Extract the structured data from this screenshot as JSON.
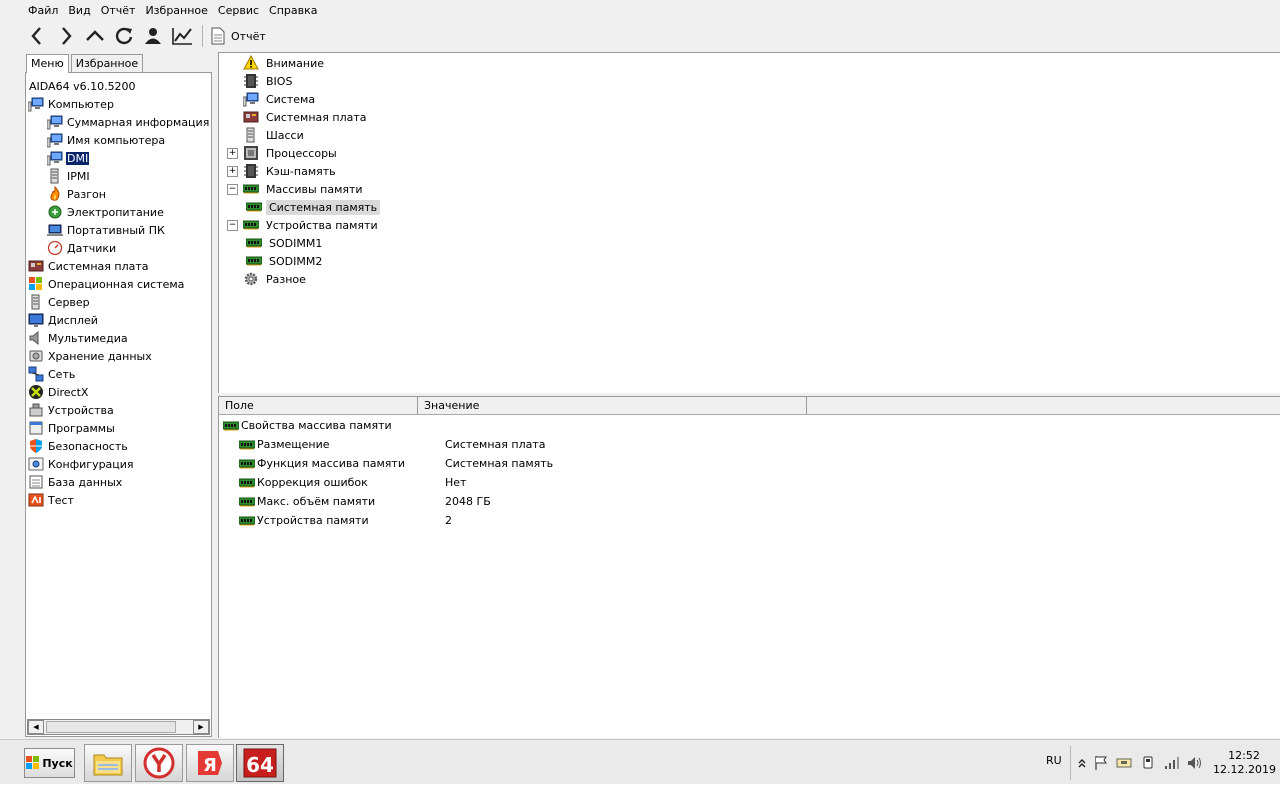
{
  "menubar": {
    "items": [
      "Файл",
      "Вид",
      "Отчёт",
      "Избранное",
      "Сервис",
      "Справка"
    ]
  },
  "toolbar": {
    "report_label": "Отчёт",
    "buttons": [
      "back-icon",
      "forward-icon",
      "up-icon",
      "refresh-icon",
      "user-icon",
      "chart-icon"
    ]
  },
  "left_tabs": [
    "Меню",
    "Избранное"
  ],
  "left_tree": [
    {
      "label": "AIDA64 v6.10.5200",
      "level": 0,
      "icon": "none"
    },
    {
      "label": "Компьютер",
      "level": 0,
      "icon": "computer-icon"
    },
    {
      "label": "Суммарная информация",
      "level": 1,
      "icon": "computer-icon"
    },
    {
      "label": "Имя компьютера",
      "level": 1,
      "icon": "computer-icon"
    },
    {
      "label": "DMI",
      "level": 1,
      "icon": "computer-icon",
      "selected": true
    },
    {
      "label": "IPMI",
      "level": 1,
      "icon": "server-icon"
    },
    {
      "label": "Разгон",
      "level": 1,
      "icon": "flame-icon"
    },
    {
      "label": "Электропитание",
      "level": 1,
      "icon": "power-icon"
    },
    {
      "label": "Портативный ПК",
      "level": 1,
      "icon": "laptop-icon"
    },
    {
      "label": "Датчики",
      "level": 1,
      "icon": "gauge-icon"
    },
    {
      "label": "Системная плата",
      "level": 0,
      "icon": "motherboard-icon"
    },
    {
      "label": "Операционная система",
      "level": 0,
      "icon": "windows-icon"
    },
    {
      "label": "Сервер",
      "level": 0,
      "icon": "server-icon"
    },
    {
      "label": "Дисплей",
      "level": 0,
      "icon": "monitor-icon"
    },
    {
      "label": "Мультимедиа",
      "level": 0,
      "icon": "speaker-icon"
    },
    {
      "label": "Хранение данных",
      "level": 0,
      "icon": "storage-icon"
    },
    {
      "label": "Сеть",
      "level": 0,
      "icon": "network-icon"
    },
    {
      "label": "DirectX",
      "level": 0,
      "icon": "directx-icon"
    },
    {
      "label": "Устройства",
      "level": 0,
      "icon": "devices-icon"
    },
    {
      "label": "Программы",
      "level": 0,
      "icon": "programs-icon"
    },
    {
      "label": "Безопасность",
      "level": 0,
      "icon": "shield-icon"
    },
    {
      "label": "Конфигурация",
      "level": 0,
      "icon": "config-icon"
    },
    {
      "label": "База данных",
      "level": 0,
      "icon": "database-icon"
    },
    {
      "label": "Тест",
      "level": 0,
      "icon": "benchmark-icon"
    }
  ],
  "right_tree": [
    {
      "label": "Внимание",
      "level": 0,
      "icon": "warning-icon",
      "expander": "none"
    },
    {
      "label": "BIOS",
      "level": 0,
      "icon": "chip-icon",
      "expander": "none"
    },
    {
      "label": "Система",
      "level": 0,
      "icon": "computer-icon",
      "expander": "none"
    },
    {
      "label": "Системная плата",
      "level": 0,
      "icon": "motherboard-icon",
      "expander": "none"
    },
    {
      "label": "Шасси",
      "level": 0,
      "icon": "server-icon",
      "expander": "none"
    },
    {
      "label": "Процессоры",
      "level": 0,
      "icon": "cpu-icon",
      "expander": "plus"
    },
    {
      "label": "Кэш-память",
      "level": 0,
      "icon": "chip-icon",
      "expander": "plus"
    },
    {
      "label": "Массивы памяти",
      "level": 0,
      "icon": "ram-icon",
      "expander": "minus"
    },
    {
      "label": "Системная память",
      "level": 1,
      "icon": "ram-icon",
      "expander": "none",
      "selected": true
    },
    {
      "label": "Устройства памяти",
      "level": 0,
      "icon": "ram-icon",
      "expander": "minus"
    },
    {
      "label": "SODIMM1",
      "level": 1,
      "icon": "ram-icon",
      "expander": "none"
    },
    {
      "label": "SODIMM2",
      "level": 1,
      "icon": "ram-icon",
      "expander": "none"
    },
    {
      "label": "Разное",
      "level": 0,
      "icon": "gear-icon",
      "expander": "none"
    }
  ],
  "grid": {
    "columns": [
      "Поле",
      "Значение",
      ""
    ],
    "group": "Свойства массива памяти",
    "rows": [
      {
        "field": "Размещение",
        "value": "Системная плата"
      },
      {
        "field": "Функция массива памяти",
        "value": "Системная память"
      },
      {
        "field": "Коррекция ошибок",
        "value": "Нет"
      },
      {
        "field": "Макс. объём памяти",
        "value": "2048 ГБ"
      },
      {
        "field": "Устройства памяти",
        "value": "2"
      }
    ]
  },
  "taskbar": {
    "start_label": "Пуск",
    "apps": [
      "explorer-icon",
      "yandex-browser-icon",
      "yandex-icon",
      "aida64-icon"
    ],
    "aida_label": "64",
    "lang": "RU",
    "time": "12:52",
    "date": "12.12.2019",
    "tray_icons": [
      "show-hidden-icon",
      "flag-icon",
      "keyboard-icon",
      "usb-icon",
      "signal-icon",
      "volume-icon"
    ]
  },
  "colors": {
    "selection": "#0a246a",
    "ram_green": "#2e8b2e",
    "aida_red": "#c81e1e"
  }
}
